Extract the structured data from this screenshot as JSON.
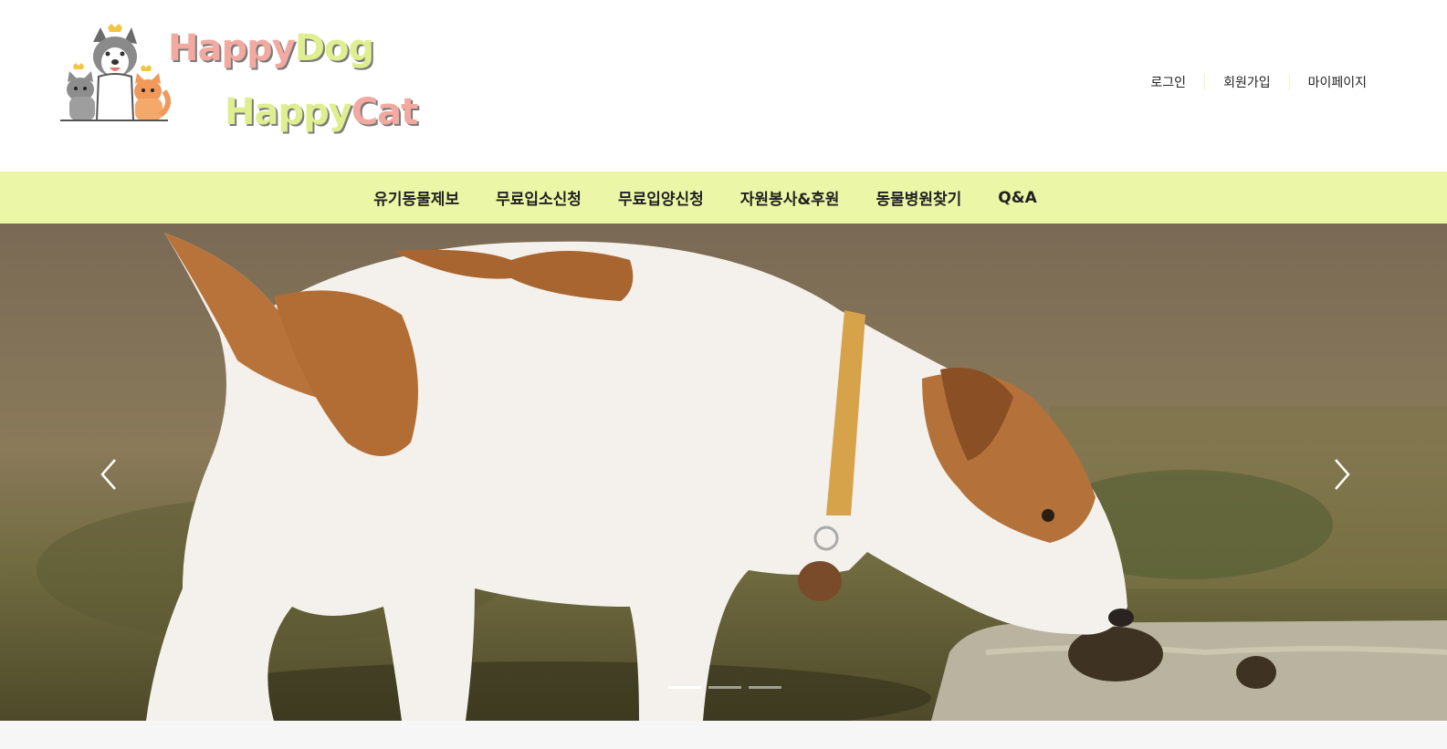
{
  "logo": {
    "line1": [
      "Happy",
      "Dog"
    ],
    "line2": [
      "Happy",
      "Cat"
    ]
  },
  "util_links": [
    {
      "label": "로그인"
    },
    {
      "label": "회원가입"
    },
    {
      "label": "마이페이지"
    }
  ],
  "nav": [
    {
      "label": "유기동물제보"
    },
    {
      "label": "무료입소신청"
    },
    {
      "label": "무료입양신청"
    },
    {
      "label": "자원봉사&후원"
    },
    {
      "label": "동물병원찾기"
    },
    {
      "label": "Q&A"
    }
  ],
  "carousel": {
    "prev_icon": "chevron-left-icon",
    "next_icon": "chevron-right-icon",
    "slide_count": 3,
    "active_index": 0
  },
  "colors": {
    "nav_bg": "#ebf7a6",
    "logo_pink": "#f2a9a0",
    "logo_lime": "#dfee8f"
  }
}
